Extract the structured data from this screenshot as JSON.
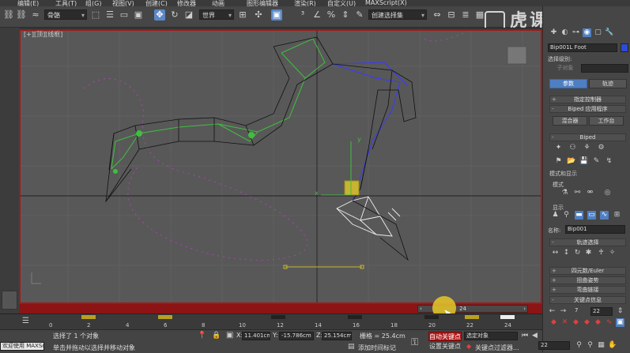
{
  "menubar": {
    "items": [
      "编辑(E)",
      "工具(T)",
      "组(G)",
      "视图(V)",
      "创建(C)",
      "修改器",
      "动画",
      "图形编辑器",
      "渲染(R)",
      "自定义(U)",
      "MAXScript(X)"
    ]
  },
  "toolbar": {
    "filter_value": "骨骼",
    "coord_value": "世界",
    "named_selection_placeholder": "创建选择集"
  },
  "viewport": {
    "label": "[+][顶][线框]",
    "timeslider_label": "24"
  },
  "timeline": {
    "labels": [
      "0",
      "2",
      "4",
      "6",
      "8",
      "10",
      "12",
      "14",
      "16",
      "18",
      "20",
      "22",
      "24"
    ]
  },
  "status": {
    "welcome": "欢迎使用 MAXSc",
    "selection_text": "选择了 1 个对象",
    "prompt_text": "单击并拖动以选择并移动对象",
    "x_label": "X:",
    "x_value": "11.401cm",
    "y_label": "Y:",
    "y_value": "-15.786cm",
    "z_label": "Z:",
    "z_value": "25.154cm",
    "grid_text": "栅格 = 25.4cm",
    "add_time_tag": "添加时间标记",
    "auto_key": "自动关键点",
    "set_key": "设置关键点",
    "selected_object": "选定对象",
    "key_filters": "关键点过滤器...",
    "frame_value": "22"
  },
  "panel": {
    "object_name": "Bip001L Foot",
    "selection_level_label": "选择级别:",
    "sub_object_button": "子对象",
    "tab_params": "参数",
    "tab_track": "轨迹",
    "rollout_assign_controller": "指定控制器",
    "rollout_biped_app": "Biped 应用程序",
    "mixer_button": "混合器",
    "workbench_button": "工作台",
    "rollout_biped": "Biped",
    "mode_display_label": "模式和显示",
    "mode_label": "模式",
    "display_label": "显示",
    "name_label": "名称:",
    "name_value": "Bip001",
    "rollout_track_selection": "轨迹选择",
    "rollout_quaternion_euler": "四元数/Euler",
    "rollout_twist_pose": "扭曲姿势",
    "rollout_bend_link": "弯曲链接",
    "rollout_key_info": "关键点信息",
    "key_number": "7",
    "key_frame": "22"
  },
  "watermark": {
    "text": "虎课网"
  },
  "colors": {
    "viewport_border": "#9e1b1b",
    "timebar_red": "#8d1414",
    "accent_blue": "#4f7fc2",
    "bone_green": "#3fbf3f",
    "bone_blue": "#3a3aff",
    "trajectory_purple": "#c040c0"
  }
}
